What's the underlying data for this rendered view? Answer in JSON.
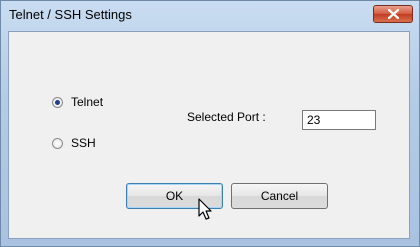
{
  "window": {
    "title": "Telnet / SSH Settings"
  },
  "protocol": {
    "options": [
      {
        "label": "Telnet",
        "selected": true
      },
      {
        "label": "SSH",
        "selected": false
      }
    ]
  },
  "port": {
    "label": "Selected Port :",
    "value": "23"
  },
  "buttons": {
    "ok_label": "OK",
    "cancel_label": "Cancel"
  },
  "icons": {
    "close": "close-icon",
    "pointer": "mouse-pointer-icon"
  }
}
